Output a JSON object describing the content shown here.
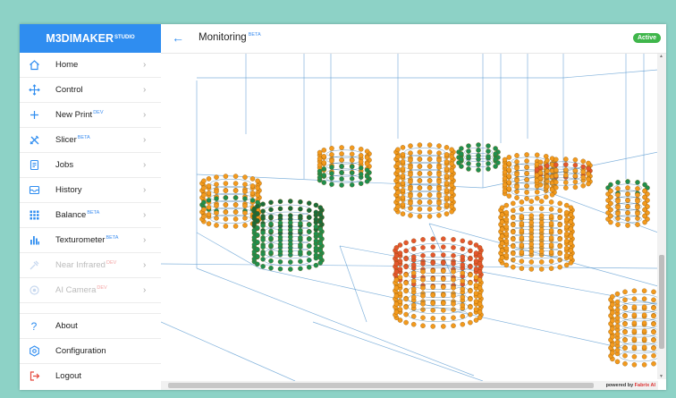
{
  "brand": {
    "name": "M3DIMAKER",
    "suffix": "STUDIO"
  },
  "sidebar": {
    "items": [
      {
        "label": "Home",
        "tag": "",
        "icon": "home-icon",
        "disabled": false
      },
      {
        "label": "Control",
        "tag": "",
        "icon": "move-arrows-icon",
        "disabled": false
      },
      {
        "label": "New Print",
        "tag": "DEV",
        "icon": "plus-icon",
        "disabled": false
      },
      {
        "label": "Slicer",
        "tag": "BETA",
        "icon": "slicer-tools-icon",
        "disabled": false
      },
      {
        "label": "Jobs",
        "tag": "",
        "icon": "document-icon",
        "disabled": false
      },
      {
        "label": "History",
        "tag": "",
        "icon": "inbox-icon",
        "disabled": false
      },
      {
        "label": "Balance",
        "tag": "BETA",
        "icon": "dot-grid-icon",
        "disabled": false
      },
      {
        "label": "Texturometer",
        "tag": "BETA",
        "icon": "bar-chart-icon",
        "disabled": false
      },
      {
        "label": "Near Infrared",
        "tag": "DEV",
        "icon": "probe-icon",
        "disabled": true
      },
      {
        "label": "AI Camera",
        "tag": "DEV",
        "icon": "camera-icon",
        "disabled": true
      }
    ],
    "bottom": [
      {
        "label": "About",
        "icon": "question-icon"
      },
      {
        "label": "Configuration",
        "icon": "settings-gear-icon"
      },
      {
        "label": "Logout",
        "icon": "logout-icon"
      }
    ],
    "chevron": "›"
  },
  "header": {
    "back_icon": "←",
    "title": "Monitoring",
    "title_tag": "BETA",
    "status": "Active"
  },
  "viewport": {
    "powered_prefix": "powered by ",
    "powered_brand": "Fabrix AI"
  },
  "colors": {
    "accent": "#2f8df0",
    "active": "#3fb64b",
    "orange": "#f39a1e",
    "green": "#1f8f4e",
    "red": "#e4572e"
  }
}
